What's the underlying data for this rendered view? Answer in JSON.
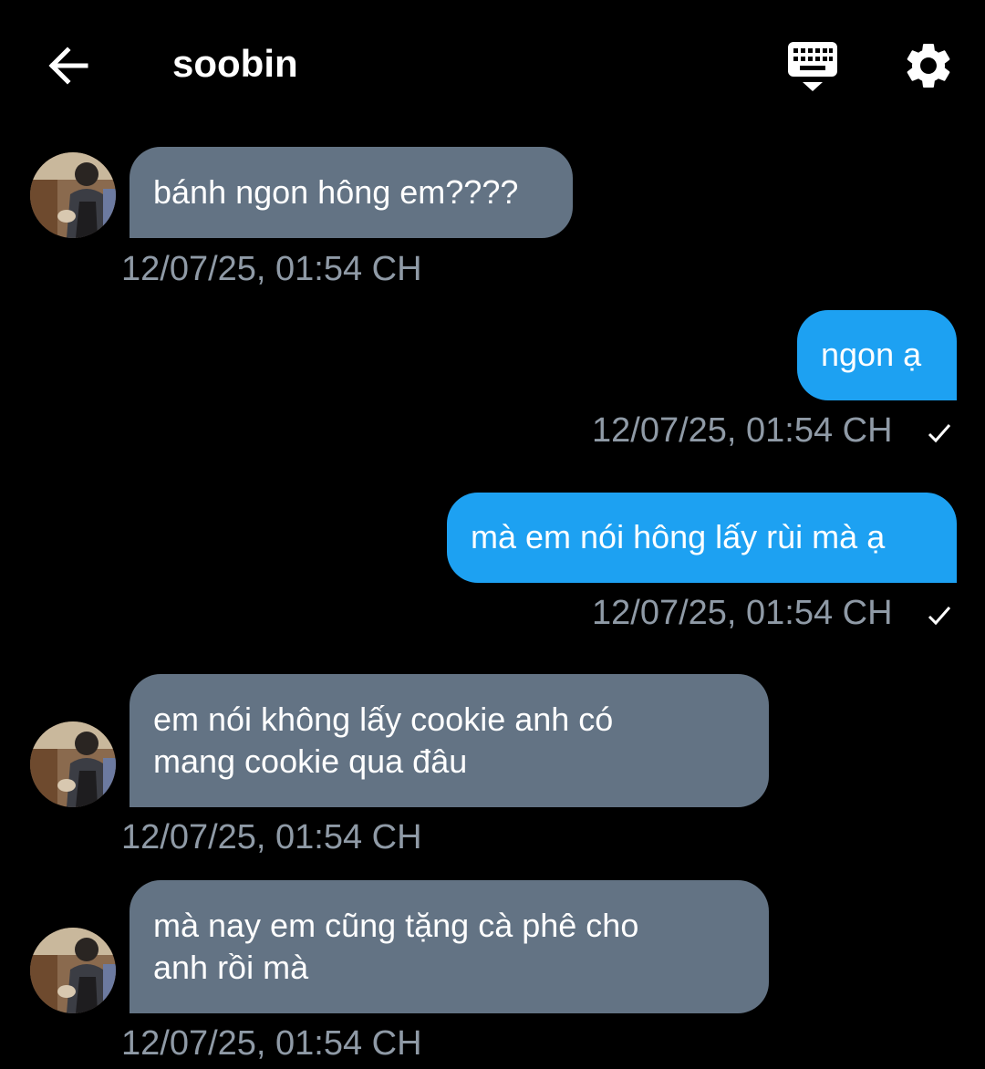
{
  "header": {
    "back_icon": "arrow-left-icon",
    "title": "soobin",
    "keyboard_icon": "keyboard-hide-icon",
    "settings_icon": "gear-icon"
  },
  "colors": {
    "background": "#000000",
    "incoming_bubble": "#637384",
    "outgoing_bubble": "#1da1f2",
    "timestamp": "#8f9aa6"
  },
  "messages": [
    {
      "direction": "incoming",
      "text_lines": [
        "bánh ngon hông em????"
      ],
      "time": "12/07/25, 01:54 CH"
    },
    {
      "direction": "outgoing",
      "text_lines": [
        "ngon ạ"
      ],
      "time": "12/07/25, 01:54 CH",
      "status_icon": "check-icon"
    },
    {
      "direction": "outgoing",
      "text_lines": [
        "mà em nói hông lấy rùi mà ạ"
      ],
      "time": "12/07/25, 01:54 CH",
      "status_icon": "check-icon"
    },
    {
      "direction": "incoming",
      "text_lines": [
        "em nói không lấy cookie anh có",
        "mang cookie qua đâu"
      ],
      "time": "12/07/25, 01:54 CH"
    },
    {
      "direction": "incoming",
      "text_lines": [
        "mà nay em cũng tặng cà phê cho",
        "anh rồi mà"
      ],
      "time": "12/07/25, 01:54 CH"
    }
  ]
}
